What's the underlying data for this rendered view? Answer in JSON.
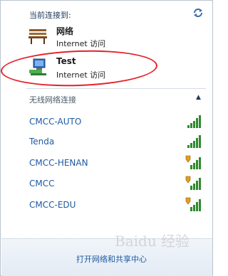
{
  "header": {
    "title": "当前连接到:",
    "refresh_icon": "refresh-icon"
  },
  "connections": [
    {
      "name": "网络",
      "status": "Internet 访问",
      "icon": "bench-network-icon"
    },
    {
      "name": "Test",
      "status": "Internet 访问",
      "icon": "computer-network-icon"
    }
  ],
  "wireless": {
    "title": "无线网络连接",
    "networks": [
      {
        "name": "CMCC-AUTO",
        "secured": false
      },
      {
        "name": "Tenda",
        "secured": false
      },
      {
        "name": "CMCC-HENAN",
        "secured": true
      },
      {
        "name": "CMCC",
        "secured": true
      },
      {
        "name": "CMCC-EDU",
        "secured": true
      }
    ]
  },
  "footer": {
    "link": "打开网络和共享中心"
  },
  "watermark": "Baidu 经验",
  "colors": {
    "link": "#1e5aa0",
    "signal": "#2e8b2e",
    "annotation": "#e5212a"
  }
}
